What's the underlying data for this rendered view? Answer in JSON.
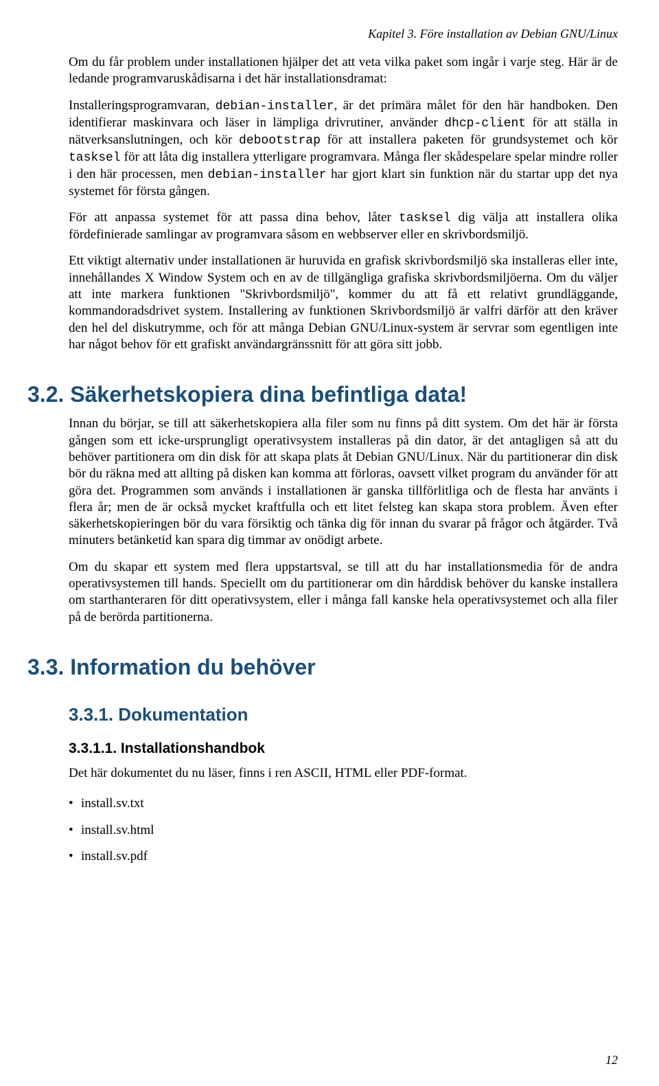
{
  "runningHead": "Kapitel 3. Före installation av Debian GNU/Linux",
  "paragraphs": {
    "p1": "Om du får problem under installationen hjälper det att veta vilka paket som ingår i varje steg. Här är de ledande programvaruskådisarna i det här installationsdramat:",
    "p2a": "Installeringsprogramvaran, ",
    "p2_code1": "debian-installer",
    "p2b": ", är det primära målet för den här handboken. Den identifierar maskinvara och läser in lämpliga drivrutiner, använder ",
    "p2_code2": "dhcp-client",
    "p2c": " för att ställa in nätverksanslutningen, och kör ",
    "p2_code3": "debootstrap",
    "p2d": " för att installera paketen för grundsystemet och kör ",
    "p2_code4": "tasksel",
    "p2e": " för att låta dig installera ytterligare programvara. Många fler skådespelare spelar mindre roller i den här processen, men ",
    "p2_code5": "debian-installer",
    "p2f": " har gjort klart sin funktion när du startar upp det nya systemet för första gången.",
    "p3a": "För att anpassa systemet för att passa dina behov, låter ",
    "p3_code1": "tasksel",
    "p3b": " dig välja att installera olika fördefinierade samlingar av programvara såsom en webbserver eller en skrivbordsmiljö.",
    "p4": "Ett viktigt alternativ under installationen är huruvida en grafisk skrivbordsmiljö ska installeras eller inte, innehållandes X Window System och en av de tillgängliga grafiska skrivbordsmiljöerna. Om du väljer att inte markera funktionen \"Skrivbordsmiljö\", kommer du att få ett relativt grundläggande, kommandoradsdrivet system. Installering av funktionen Skrivbordsmiljö är valfri därför att den kräver den hel del diskutrymme, och för att många Debian GNU/Linux-system är servrar som egentligen inte har något behov för ett grafiskt användargränssnitt för att göra sitt jobb."
  },
  "section32": {
    "title": "3.2. Säkerhetskopiera dina befintliga data!",
    "p1": "Innan du börjar, se till att säkerhetskopiera alla filer som nu finns på ditt system. Om det här är första gången som ett icke-ursprungligt operativsystem installeras på din dator, är det antagligen så att du behöver partitionera om din disk för att skapa plats åt Debian GNU/Linux. När du partitionerar din disk bör du räkna med att allting på disken kan komma att förloras, oavsett vilket program du använder för att göra det. Programmen som används i installationen är ganska tillförlitliga och de flesta har använts i flera år; men de är också mycket kraftfulla och ett litet felsteg kan skapa stora problem. Även efter säkerhetskopieringen bör du vara försiktig och tänka dig för innan du svarar på frågor och åtgärder. Två minuters betänketid kan spara dig timmar av onödigt arbete.",
    "p2": "Om du skapar ett system med flera uppstartsval, se till att du har installationsmedia för de andra operativsystemen till hands. Speciellt om du partitionerar om din hårddisk behöver du kanske installera om starthanteraren för ditt operativsystem, eller i många fall kanske hela operativsystemet och alla filer på de berörda partitionerna."
  },
  "section33": {
    "title": "3.3. Information du behöver",
    "sub331": {
      "title": "3.3.1. Dokumentation",
      "sub3311": {
        "title": "3.3.1.1. Installationshandbok",
        "p1": "Det här dokumentet du nu läser, finns i ren ASCII, HTML eller PDF-format.",
        "files": [
          "install.sv.txt",
          "install.sv.html",
          "install.sv.pdf"
        ]
      }
    }
  },
  "pageNumber": "12"
}
